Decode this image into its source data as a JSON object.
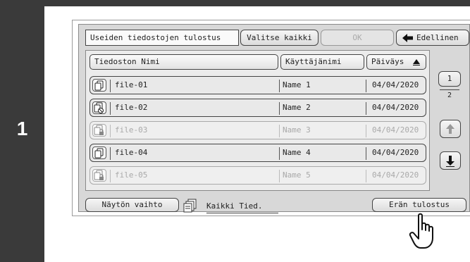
{
  "step": {
    "number": "1"
  },
  "header": {
    "title": "Useiden tiedostojen tulostus",
    "select_all_label": "Valitse kaikki",
    "ok_label": "OK",
    "back_label": "Edellinen"
  },
  "columns": {
    "file_name": "Tiedoston Nimi",
    "user_name": "Käyttäjänimi",
    "date": "Päiväys"
  },
  "rows": [
    {
      "file": "file-01",
      "user": "Name 1",
      "date": "04/04/2020",
      "icon": "copy-document-icon",
      "enabled": true
    },
    {
      "file": "file-02",
      "user": "Name 2",
      "date": "04/04/2020",
      "icon": "copy-blocked-icon",
      "enabled": true
    },
    {
      "file": "file-03",
      "user": "Name 3",
      "date": "04/04/2020",
      "icon": "copy-locked-icon",
      "enabled": false
    },
    {
      "file": "file-04",
      "user": "Name 4",
      "date": "04/04/2020",
      "icon": "copy-document-icon",
      "enabled": true
    },
    {
      "file": "file-05",
      "user": "Name 5",
      "date": "04/04/2020",
      "icon": "copy-locked-icon",
      "enabled": false
    }
  ],
  "pager": {
    "current": "1",
    "total": "2"
  },
  "footer": {
    "switch_view_label": "Näytön vaihto",
    "filter_value": "Kaikki Tied.",
    "batch_print_label": "Erän tulostus"
  },
  "colors": {
    "frame": "#3a3a3a",
    "panel": "#d8d8d8",
    "disabled_text": "#a9a9a9"
  }
}
